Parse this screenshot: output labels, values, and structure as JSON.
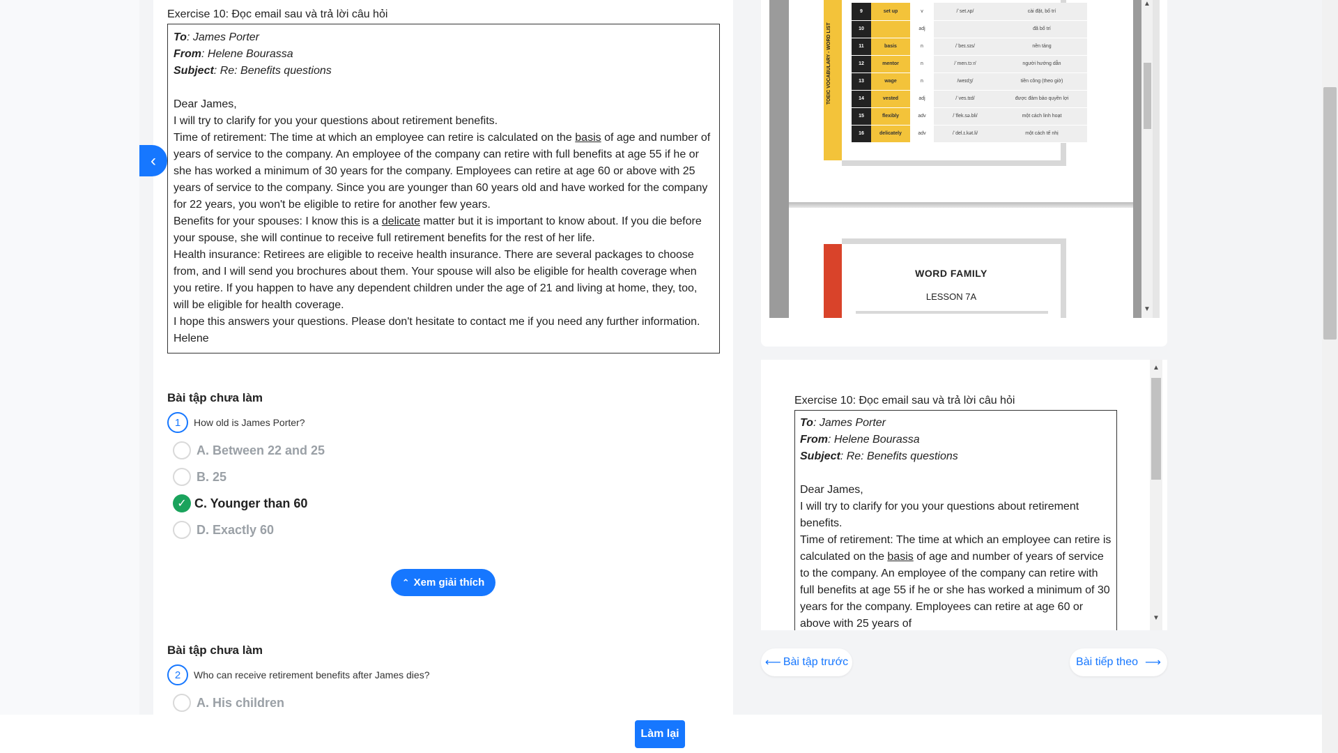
{
  "exercise_title": "Exercise 10: Đọc email sau và trả lời câu hỏi",
  "email": {
    "to_label": "To",
    "to_value": ": James Porter",
    "from_label": "From",
    "from_value": ": Helene Bourassa",
    "subject_label": "Subject",
    "subject_value": ": Re: Benefits questions",
    "greeting": "Dear James,",
    "intro": "I will try to clarify for you your questions about retirement benefits.",
    "p1_a": "Time of retirement: The time at which an employee can retire is calculated on the ",
    "p1_word": "basis",
    "p1_b": " of age and number of years of service to the company. An employee of the company can retire with full benefits at age 55 if he or she has worked a minimum of 30 years for the company. Employees can retire at age 60 or above with 25 years of service to the company. Since you are younger than 60 years old and have worked for the company for 22 years, you won't be eligible to retire for another few years.",
    "p2_a": "Benefits for your spouses: I know this is a ",
    "p2_word": "delicate",
    "p2_b": " matter but it is important to know about. If you die before your spouse, she will continue to receive full retirement benefits for the rest of her life.",
    "p3": "Health insurance: Retirees are eligible to receive health insurance. There are several packages to choose from, and I will send you brochures about them. Your spouse will also be eligible for health coverage when you retire. If you happen to have any dependent children under the age of 21 and living at home, they, too, will be eligible for health coverage.",
    "p4": "I hope this answers your questions. Please don't hesitate to contact me if you need any further information.",
    "signature": "Helene"
  },
  "questions": [
    {
      "heading": "Bài tập chưa làm",
      "number": "1",
      "text": "How old is James Porter?",
      "options": [
        "A. Between 22 and 25",
        "B. 25",
        "C. Younger than 60",
        "D. Exactly 60"
      ],
      "selected_index": 2
    },
    {
      "heading": "Bài tập chưa làm",
      "number": "2",
      "text": "Who can receive retirement benefits after James dies?",
      "options": [
        "A. His children"
      ]
    }
  ],
  "explain_button": "Xem giải thích",
  "vocab_rows": [
    {
      "n": "9",
      "word": "set up",
      "pos": "v",
      "ipa": "/ˈset.ʌp/",
      "meaning": "cài đặt, bố trí"
    },
    {
      "n": "10",
      "word": "",
      "pos": "adj",
      "ipa": "",
      "meaning": "đã bố trí"
    },
    {
      "n": "11",
      "word": "basis",
      "pos": "n",
      "ipa": "/ˈbeɪ.sɪs/",
      "meaning": "nền tảng"
    },
    {
      "n": "12",
      "word": "mentor",
      "pos": "n",
      "ipa": "/ˈmen.tɔːr/",
      "meaning": "người hướng dẫn"
    },
    {
      "n": "13",
      "word": "wage",
      "pos": "n",
      "ipa": "/weɪdʒ/",
      "meaning": "tiền công (theo giờ)"
    },
    {
      "n": "14",
      "word": "vested",
      "pos": "adj",
      "ipa": "/ˈves.tɪd/",
      "meaning": "được đảm bảo quyền lợi"
    },
    {
      "n": "15",
      "word": "flexibly",
      "pos": "adv",
      "ipa": "/ˈflek.sə.bli/",
      "meaning": "một cách linh hoạt"
    },
    {
      "n": "16",
      "word": "delicately",
      "pos": "adv",
      "ipa": "/ˈdel.ɪ.kət.li/",
      "meaning": "một cách tế nhị"
    }
  ],
  "vocab_side_label": "TOEIC VOCABULARY - WORD LIST",
  "word_family": {
    "title": "WORD FAMILY",
    "lesson": "LESSON 7A"
  },
  "preview": {
    "title": "Exercise 10: Đọc email sau và trả lời câu hỏi",
    "lines": [
      "Dear James,",
      "I will try to clarify for you your questions about retirement benefits.",
      "Time of retirement: The time at which an employee can retire is calculated on the ",
      " of age and number of years of service to the company. An employee of the company can retire with full benefits at age 55 if he or she has worked a minimum of 30 years for the company. Employees can retire at age 60 or above with 25 years of"
    ]
  },
  "nav": {
    "prev": "Bài tập trước",
    "next": "Bài tiếp theo"
  },
  "retry_button": "Làm lại",
  "colors": {
    "accent": "#1677ff",
    "correct": "#1aa35c",
    "vocab_yellow": "#f3c33a",
    "word_family_red": "#d9432a"
  }
}
